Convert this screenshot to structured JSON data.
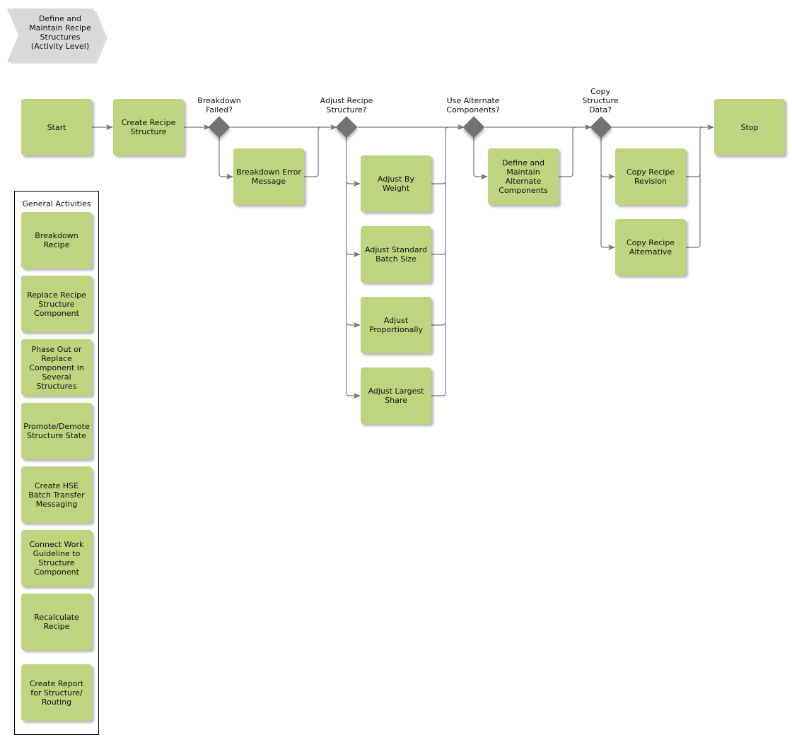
{
  "header": {
    "title": "Define and\nMaintain Recipe\nStructures\n(Activity Level)",
    "chevron_color": "#d9d9d9"
  },
  "colors": {
    "activity_fill": "#bed47e",
    "gateway_fill": "#737373",
    "connector": "#777777"
  },
  "flow": {
    "start": "Start",
    "create_recipe_structure": "Create Recipe\nStructure",
    "gateway_breakdown_failed": "Breakdown\nFailed?",
    "breakdown_error_message": "Breakdown Error\nMessage",
    "gateway_adjust_recipe": "Adjust Recipe\nStructure?",
    "adjust_by_weight": "Adjust By\nWeight",
    "adjust_standard_batch_size": "Adjust Standard\nBatch Size",
    "adjust_proportionally": "Adjust\nProportionally",
    "adjust_largest_share": "Adjust Largest\nShare",
    "gateway_use_alternate": "Use Alternate\nComponents?",
    "define_alternate_components": "Define and\nMaintain\nAlternate\nComponents",
    "gateway_copy_structure": "Copy\nStructure\nData?",
    "copy_recipe_revision": "Copy Recipe\nRevision",
    "copy_recipe_alternative": "Copy Recipe\nAlternative",
    "stop": "Stop"
  },
  "general_activities": {
    "title": "General Activities",
    "items": [
      "Breakdown\nRecipe",
      "Replace Recipe\nStructure\nComponent",
      "Phase Out or\nReplace\nComponent in\nSeveral\nStructures",
      "Promote/Demote\nStructure State",
      "Create HSE\nBatch Transfer\nMessaging",
      "Connect Work\nGuideline to\nStructure\nComponent",
      "Recalculate\nRecipe",
      "Create Report\nfor Structure/\nRouting"
    ]
  }
}
